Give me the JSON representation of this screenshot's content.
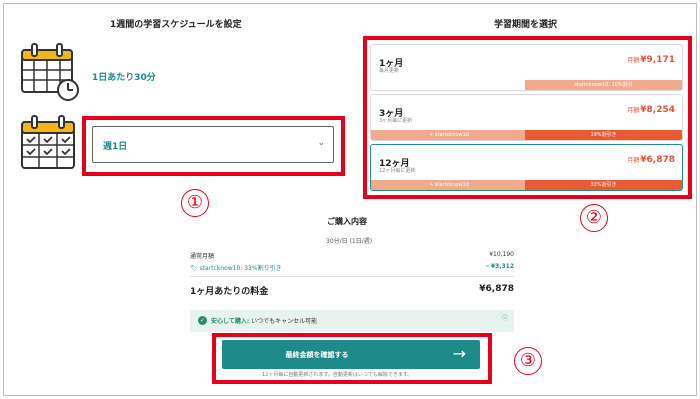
{
  "left_heading": "1週間の学習スケジュールを設定",
  "right_heading": "学習期間を選択",
  "per_day_text": "1日あたり30分",
  "frequency_select": {
    "value": "週1日"
  },
  "step_numbers": [
    "①",
    "②",
    "③"
  ],
  "plans": [
    {
      "name": "1ヶ月",
      "sub": "毎月更新",
      "price_prefix": "月額",
      "price": "¥9,171",
      "bar_right": "startcknow10: 10%割引"
    },
    {
      "name": "3ヶ月",
      "sub": "3ヶ月毎に更新",
      "price_prefix": "月額",
      "price": "¥8,254",
      "bar_left": "+ startcknow10",
      "bar_right": "19%割引き"
    },
    {
      "name": "12ヶ月",
      "sub": "12ヶ月毎に更新",
      "price_prefix": "月額",
      "price": "¥6,878",
      "bar_left": "+ startcknow10",
      "bar_right": "33%割引き",
      "selected": true
    }
  ],
  "summary": {
    "title": "ご購入内容",
    "subtitle": "30分/日 (1日/週)",
    "regular_label": "通常月額",
    "regular_value": "¥10,190",
    "discount_label": "startcknow10: 33%割り引き",
    "discount_value": "- ¥3,312",
    "total_label": "1ヶ月あたりの料金",
    "total_value": "¥6,878"
  },
  "safe": {
    "bold": "安心して購入:",
    "text": "いつでもキャンセル可能"
  },
  "confirm_button": {
    "label": "最終金額を確認する",
    "arrow": "→"
  },
  "footnote": "12ヶ月毎に自動更新されます。自動更新はいつでも解除できます。",
  "colors": {
    "teal": "#1e8a8a",
    "orange": "#ea5a35",
    "light_orange": "#f2a98e",
    "red_box": "#e5001c",
    "calendar_yellow": "#f2b51c"
  }
}
